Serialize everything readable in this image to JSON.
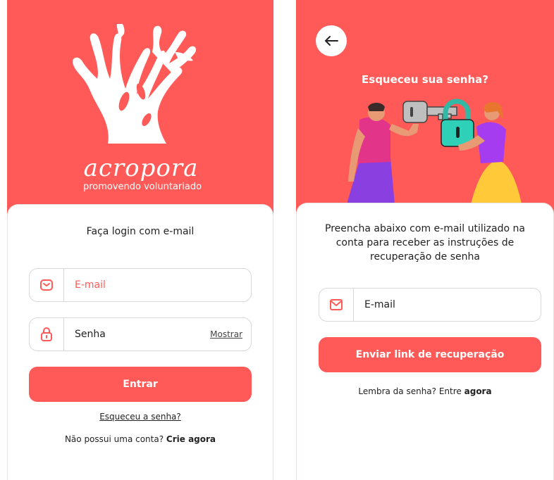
{
  "colors": {
    "brand": "#FF5A57",
    "white": "#FFFFFF"
  },
  "login": {
    "brand_name": "acropora",
    "tagline": "promovendo voluntariado",
    "title": "Faça login com e-mail",
    "email_placeholder": "E-mail",
    "email_icon": "mail-icon",
    "password_placeholder": "Senha",
    "password_icon": "lock-icon",
    "show_label": "Mostrar",
    "submit_label": "Entrar",
    "forgot_label": "Esqueceu a senha?",
    "signup_text": "Não possui uma conta?",
    "signup_link": "Crie agora"
  },
  "recovery": {
    "back_icon": "arrow-left-icon",
    "title": "Esqueceu sua senha?",
    "instructions_line1": "Preencha abaixo com e-mail utilizado na",
    "instructions_line2": "conta para receber as instruções de",
    "instructions_line3": "recuperação de senha",
    "email_placeholder": "E-mail",
    "email_icon": "mail-icon",
    "submit_label": "Enviar link de recuperação",
    "remember_text": "Lembra da senha? Entre",
    "remember_link": "agora"
  }
}
